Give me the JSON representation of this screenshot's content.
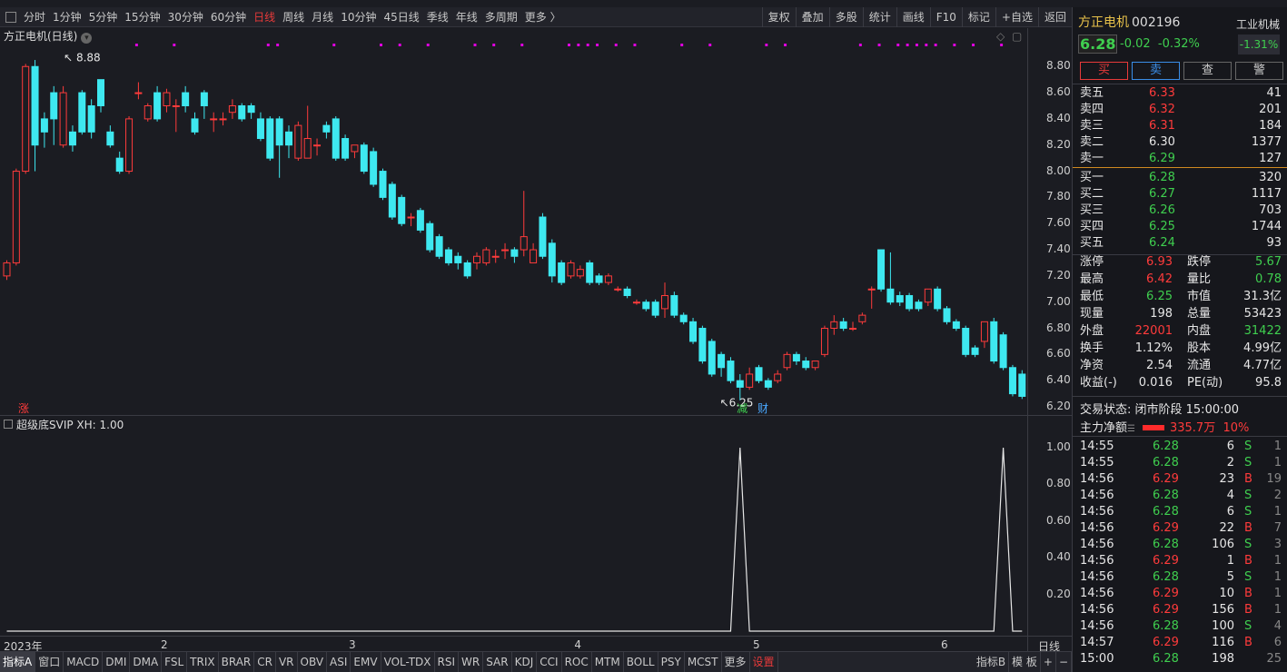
{
  "toolbar": {
    "periods": [
      "分时",
      "1分钟",
      "5分钟",
      "15分钟",
      "30分钟",
      "60分钟",
      "日线",
      "周线",
      "月线",
      "10分钟",
      "45日线",
      "季线",
      "年线",
      "多周期",
      "更多 〉"
    ],
    "active": "日线",
    "right": [
      "复权",
      "叠加",
      "多股",
      "统计",
      "画线",
      "F10",
      "标记",
      "+自选",
      "返回"
    ]
  },
  "chart_title": "方正电机(日线)",
  "annotations": {
    "high": "8.88",
    "low": "6.25",
    "zhang": "涨",
    "jian": "减",
    "cai": "财"
  },
  "price_axis": [
    "8.80",
    "8.60",
    "8.40",
    "8.20",
    "8.00",
    "7.80",
    "7.60",
    "7.40",
    "7.20",
    "7.00",
    "6.80",
    "6.60",
    "6.40",
    "6.20"
  ],
  "indicator_title": "超级底SVIP  XH: 1.00",
  "indicator_axis": [
    "1.00",
    "0.80",
    "0.60",
    "0.40",
    "0.20"
  ],
  "x_ticks": [
    "2023年",
    "2",
    "3",
    "4",
    "5",
    "6"
  ],
  "period_label": "日线",
  "bottom_tabs": [
    "指标A",
    "窗口",
    "MACD",
    "DMI",
    "DMA",
    "FSL",
    "TRIX",
    "BRAR",
    "CR",
    "VR",
    "OBV",
    "ASI",
    "EMV",
    "VOL-TDX",
    "RSI",
    "WR",
    "SAR",
    "KDJ",
    "CCI",
    "ROC",
    "MTM",
    "BOLL",
    "PSY",
    "MCST",
    "更多",
    "设置"
  ],
  "bottom_right": [
    "指标B",
    "模 板",
    "+",
    "−"
  ],
  "colors": {
    "up": "#ff3b3b",
    "down": "#3ee8f0",
    "bg": "#1b1c22",
    "markers": "#e000e0"
  },
  "chart_data": {
    "type": "candlestick",
    "open": [
      7.2,
      7.3,
      8.0,
      8.8,
      8.4,
      8.6,
      8.2,
      8.3,
      8.6,
      8.5,
      8.7,
      8.3,
      8.1,
      8.0,
      8.6,
      8.4,
      8.6,
      8.5,
      8.5,
      8.6,
      8.4,
      8.6,
      8.4,
      8.4,
      8.45,
      8.5,
      8.5,
      8.4,
      8.4,
      8.4,
      8.3,
      8.1,
      8.1,
      8.2,
      8.35,
      8.4,
      8.25,
      8.15,
      8.2,
      8.15,
      8.0,
      7.9,
      7.8,
      7.65,
      7.7,
      7.6,
      7.5,
      7.4,
      7.35,
      7.3,
      7.3,
      7.3,
      7.35,
      7.4,
      7.4,
      7.4,
      7.3,
      7.65,
      7.45,
      7.3,
      7.2,
      7.2,
      7.3,
      7.2,
      7.15,
      7.1,
      7.1,
      7.0,
      7.0,
      7.0,
      6.95,
      7.05,
      6.9,
      6.85,
      6.8,
      6.7,
      6.6,
      6.55,
      6.4,
      6.35,
      6.5,
      6.4,
      6.4,
      6.5,
      6.6,
      6.55,
      6.5,
      6.6,
      6.8,
      6.85,
      6.8,
      6.85,
      7.1,
      7.4,
      7.1,
      7.05,
      7.05,
      7.0,
      7.0,
      7.1,
      6.95,
      6.85,
      6.8,
      6.65,
      6.7,
      6.85,
      6.75,
      6.5,
      6.45
    ],
    "close": [
      7.3,
      8.0,
      8.8,
      8.2,
      8.3,
      8.4,
      8.6,
      8.2,
      8.3,
      8.3,
      8.5,
      8.2,
      8.0,
      8.4,
      8.6,
      8.5,
      8.4,
      8.6,
      8.5,
      8.5,
      8.3,
      8.5,
      8.4,
      8.4,
      8.5,
      8.4,
      8.45,
      8.25,
      8.1,
      8.2,
      8.2,
      8.35,
      8.25,
      8.2,
      8.3,
      8.1,
      8.1,
      8.2,
      8.0,
      7.9,
      7.8,
      7.65,
      7.6,
      7.65,
      7.55,
      7.4,
      7.35,
      7.3,
      7.3,
      7.2,
      7.35,
      7.4,
      7.35,
      7.4,
      7.35,
      7.5,
      7.4,
      7.35,
      7.2,
      7.15,
      7.3,
      7.25,
      7.15,
      7.15,
      7.2,
      7.1,
      7.05,
      7.0,
      6.95,
      6.9,
      7.05,
      6.9,
      6.85,
      6.7,
      6.55,
      6.45,
      6.5,
      6.4,
      6.35,
      6.45,
      6.4,
      6.35,
      6.45,
      6.6,
      6.55,
      6.5,
      6.55,
      6.8,
      6.85,
      6.8,
      6.8,
      6.9,
      7.1,
      7.1,
      7.0,
      7.0,
      6.95,
      6.95,
      7.1,
      6.95,
      6.85,
      6.8,
      6.6,
      6.6,
      6.85,
      6.55,
      6.5,
      6.3,
      6.28
    ],
    "high": [
      7.32,
      8.02,
      8.82,
      8.85,
      8.45,
      8.65,
      8.65,
      8.35,
      8.62,
      8.55,
      8.7,
      8.35,
      8.15,
      8.42,
      8.68,
      8.52,
      8.65,
      8.63,
      8.55,
      8.65,
      8.45,
      8.62,
      8.45,
      8.45,
      8.55,
      8.52,
      8.52,
      8.45,
      8.42,
      8.42,
      8.35,
      8.38,
      8.5,
      8.25,
      8.38,
      8.42,
      8.28,
      8.2,
      8.22,
      8.18,
      8.02,
      7.92,
      7.82,
      7.68,
      7.72,
      7.62,
      7.52,
      7.42,
      7.38,
      7.32,
      7.38,
      7.42,
      7.4,
      7.45,
      7.42,
      7.85,
      7.45,
      7.68,
      7.48,
      7.32,
      7.32,
      7.28,
      7.32,
      7.22,
      7.22,
      7.12,
      7.12,
      7.02,
      7.02,
      7.02,
      7.15,
      7.08,
      6.92,
      6.88,
      6.82,
      6.72,
      6.62,
      6.58,
      6.45,
      6.5,
      6.52,
      6.42,
      6.48,
      6.62,
      6.62,
      6.58,
      6.52,
      6.82,
      6.9,
      6.88,
      6.85,
      6.92,
      7.12,
      7.4,
      7.38,
      7.08,
      7.07,
      7.02,
      7.02,
      7.12,
      6.97,
      6.87,
      6.82,
      6.67,
      6.85,
      6.88,
      6.77,
      6.52,
      6.48
    ],
    "low": [
      7.17,
      7.28,
      7.98,
      8.0,
      8.18,
      8.2,
      8.18,
      8.15,
      8.28,
      8.25,
      8.45,
      8.18,
      7.98,
      7.98,
      8.55,
      8.38,
      8.38,
      8.45,
      8.3,
      8.45,
      8.28,
      8.4,
      8.3,
      8.35,
      8.4,
      8.38,
      8.4,
      8.23,
      8.08,
      7.95,
      8.1,
      8.08,
      8.1,
      8.12,
      8.25,
      8.08,
      8.08,
      8.1,
      7.98,
      7.88,
      7.78,
      7.63,
      7.58,
      7.58,
      7.53,
      7.38,
      7.33,
      7.28,
      7.25,
      7.18,
      7.25,
      7.28,
      7.3,
      7.33,
      7.3,
      7.35,
      7.3,
      7.33,
      7.15,
      7.13,
      7.18,
      7.18,
      7.13,
      7.13,
      7.13,
      7.08,
      7.03,
      6.98,
      6.93,
      6.88,
      6.88,
      6.88,
      6.83,
      6.68,
      6.53,
      6.43,
      6.43,
      6.38,
      6.25,
      6.33,
      6.38,
      6.33,
      6.38,
      6.48,
      6.52,
      6.48,
      6.48,
      6.58,
      6.75,
      6.78,
      6.78,
      6.83,
      6.95,
      7.08,
      6.98,
      6.97,
      6.93,
      6.93,
      6.97,
      6.93,
      6.83,
      6.78,
      6.58,
      6.58,
      6.65,
      6.53,
      6.48,
      6.28,
      6.26
    ],
    "indicator": {
      "name": "超级底SVIP",
      "value_label": "XH: 1.00",
      "signals_at": [
        78,
        106
      ],
      "ylim": [
        0,
        1
      ]
    },
    "ylim": [
      6.2,
      8.9
    ],
    "grid": false
  },
  "panel": {
    "name": "方正电机",
    "code": "002196",
    "industry": "工业机械",
    "industry_pct": "-1.31%",
    "price": "6.28",
    "change": "-0.02",
    "change_pct": "-0.32%",
    "buttons": [
      "买",
      "卖",
      "查",
      "警"
    ],
    "asks": [
      [
        "卖五",
        "6.33",
        "41",
        "red"
      ],
      [
        "卖四",
        "6.32",
        "201",
        "red"
      ],
      [
        "卖三",
        "6.31",
        "184",
        "red"
      ],
      [
        "卖二",
        "6.30",
        "1377",
        "white"
      ],
      [
        "卖一",
        "6.29",
        "127",
        "green"
      ]
    ],
    "bids": [
      [
        "买一",
        "6.28",
        "320",
        "green"
      ],
      [
        "买二",
        "6.27",
        "1117",
        "green"
      ],
      [
        "买三",
        "6.26",
        "703",
        "green"
      ],
      [
        "买四",
        "6.25",
        "1744",
        "green"
      ],
      [
        "买五",
        "6.24",
        "93",
        "green"
      ]
    ],
    "stats": [
      [
        [
          "涨停",
          "6.93",
          "red"
        ],
        [
          "跌停",
          "5.67",
          "green"
        ]
      ],
      [
        [
          "最高",
          "6.42",
          "red"
        ],
        [
          "量比",
          "0.78",
          "green"
        ]
      ],
      [
        [
          "最低",
          "6.25",
          "green"
        ],
        [
          "市值",
          "31.3亿",
          "white"
        ]
      ],
      [
        [
          "现量",
          "198",
          "white"
        ],
        [
          "总量",
          "53423",
          "white"
        ]
      ],
      [
        [
          "外盘",
          "22001",
          "red"
        ],
        [
          "内盘",
          "31422",
          "green"
        ]
      ],
      [
        [
          "换手",
          "1.12%",
          "white"
        ],
        [
          "股本",
          "4.99亿",
          "white"
        ]
      ],
      [
        [
          "净资",
          "2.54",
          "white"
        ],
        [
          "流通",
          "4.77亿",
          "white"
        ]
      ],
      [
        [
          "收益(-)",
          "0.016",
          "white"
        ],
        [
          "PE(动)",
          "95.8",
          "white"
        ]
      ]
    ],
    "trade_status": "交易状态: 闭市阶段 15:00:00",
    "main_flow_label": "主力净额",
    "main_flow_value": "335.7万",
    "main_flow_pct": "10%",
    "ticks": [
      [
        "14:55",
        "6.28",
        "6",
        "S",
        "1"
      ],
      [
        "14:55",
        "6.28",
        "2",
        "S",
        "1"
      ],
      [
        "14:56",
        "6.29",
        "23",
        "B",
        "19"
      ],
      [
        "14:56",
        "6.28",
        "4",
        "S",
        "2"
      ],
      [
        "14:56",
        "6.28",
        "6",
        "S",
        "1"
      ],
      [
        "14:56",
        "6.29",
        "22",
        "B",
        "7"
      ],
      [
        "14:56",
        "6.28",
        "106",
        "S",
        "3"
      ],
      [
        "14:56",
        "6.29",
        "1",
        "B",
        "1"
      ],
      [
        "14:56",
        "6.28",
        "5",
        "S",
        "1"
      ],
      [
        "14:56",
        "6.29",
        "10",
        "B",
        "1"
      ],
      [
        "14:56",
        "6.29",
        "156",
        "B",
        "1"
      ],
      [
        "14:56",
        "6.28",
        "100",
        "S",
        "4"
      ],
      [
        "14:57",
        "6.29",
        "116",
        "B",
        "6"
      ],
      [
        "15:00",
        "6.28",
        "198",
        "",
        "25"
      ]
    ]
  }
}
